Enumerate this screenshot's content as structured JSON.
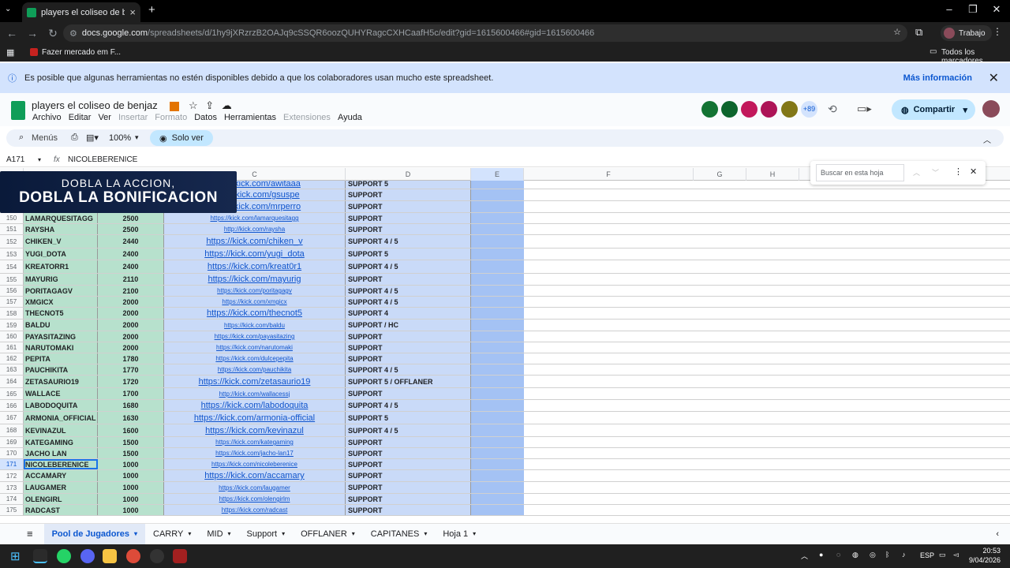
{
  "browser": {
    "tab_title": "players el coliseo de benjaz - H",
    "url_domain": "docs.google.com",
    "url_rest": "/spreadsheets/d/1hy9jXRzrzB2OAJq9cSSQR6oozQUHYRagcCXHCaafH5c/edit?gid=1615600466#gid=1615600466",
    "profile": "Trabajo",
    "bookmark": "Fazer mercado em F...",
    "bookmarks_all": "Todos los marcadores"
  },
  "infobar": {
    "text": "Es posible que algunas herramientas no estén disponibles debido a que los colaboradores usan mucho este spreadsheet.",
    "more": "Más información"
  },
  "doc": {
    "title": "players el coliseo de benjaz",
    "menus": [
      "Archivo",
      "Editar",
      "Ver",
      "Insertar",
      "Formato",
      "Datos",
      "Herramientas",
      "Extensiones",
      "Ayuda"
    ],
    "collaborators_extra": "+89",
    "share": "Compartir"
  },
  "toolbar": {
    "menus": "Menús",
    "zoom": "100%",
    "mode": "Solo ver"
  },
  "formula": {
    "cell": "A171",
    "value": "NICOLEBERENICE"
  },
  "columns": [
    "C",
    "D",
    "E",
    "F",
    "G",
    "H"
  ],
  "search_placeholder": "Buscar en esta hoja",
  "banner": {
    "line1": "DOBLA LA ACCION,",
    "line2": "DOBLA LA BONIFICACION"
  },
  "top_partial": [
    {
      "c": "https://kick.com/awitaaa",
      "d": "SUPPORT 5"
    },
    {
      "c": "https://kick.com/gsuspe",
      "d": "SUPPORT"
    },
    {
      "c": "https://kick.com/mrperro",
      "d": "SUPPORT"
    }
  ],
  "rows": [
    {
      "n": "150",
      "a": "LAMARQUESITAGG",
      "b": "2500",
      "c": "https://kick.com/lamarquesitagg",
      "d": "SUPPORT"
    },
    {
      "n": "151",
      "a": "RAYSHA",
      "b": "2500",
      "c": "http://kick.com/raysha",
      "d": "SUPPORT"
    },
    {
      "n": "152",
      "a": "CHIKEN_V",
      "b": "2440",
      "c": "https://kick.com/chiken_v",
      "d": "SUPPORT 4 / 5"
    },
    {
      "n": "153",
      "a": "YUGI_DOTA",
      "b": "2400",
      "c": "https://kick.com/yugi_dota",
      "d": "SUPPORT 5"
    },
    {
      "n": "154",
      "a": "KREATORR1",
      "b": "2400",
      "c": "https://kick.com/kreat0r1",
      "d": "SUPPORT 4 / 5"
    },
    {
      "n": "155",
      "a": "MAYURIG",
      "b": "2110",
      "c": "https://kick.com/mayurig",
      "d": "SUPPORT"
    },
    {
      "n": "156",
      "a": "PORITAGAGV",
      "b": "2100",
      "c": "https://kick.com/poritagagv",
      "d": "SUPPORT 4 / 5"
    },
    {
      "n": "157",
      "a": "XMGICX",
      "b": "2000",
      "c": "https://kick.com/xmgicx",
      "d": "SUPPORT 4 / 5"
    },
    {
      "n": "158",
      "a": "THECNOT5",
      "b": "2000",
      "c": "https://kick.com/thecnot5",
      "d": "SUPPORT 4"
    },
    {
      "n": "159",
      "a": "BALDU",
      "b": "2000",
      "c": "https://kick.com/baldu",
      "d": "SUPPORT / HC"
    },
    {
      "n": "160",
      "a": "PAYASITAZING",
      "b": "2000",
      "c": "https://kick.com/payasitazing",
      "d": "SUPPORT"
    },
    {
      "n": "161",
      "a": "NARUTOMAKI",
      "b": "2000",
      "c": "https://kick.com/narutomaki",
      "d": "SUPPORT"
    },
    {
      "n": "162",
      "a": "PEPITA",
      "b": "1780",
      "c": "https://kick.com/dulcepepita",
      "d": "SUPPORT"
    },
    {
      "n": "163",
      "a": "PAUCHIKITA",
      "b": "1770",
      "c": "https://kick.com/pauchikita",
      "d": "SUPPORT 4 / 5"
    },
    {
      "n": "164",
      "a": "ZETASAURIO19",
      "b": "1720",
      "c": "https://kick.com/zetasaurio19",
      "d": "SUPPORT 5 / OFFLANER"
    },
    {
      "n": "165",
      "a": "WALLACE",
      "b": "1700",
      "c": "http://kick.com/wallacessj",
      "d": "SUPPORT"
    },
    {
      "n": "166",
      "a": "LABODOQUITA",
      "b": "1680",
      "c": "https://kick.com/labodoquita",
      "d": "SUPPORT 4 / 5"
    },
    {
      "n": "167",
      "a": "ARMONIA_OFFICIAL",
      "b": "1630",
      "c": "https://kick.com/armonia-official",
      "d": "SUPPORT 5"
    },
    {
      "n": "168",
      "a": "KEVINAZUL",
      "b": "1600",
      "c": "https://kick.com/kevinazul",
      "d": "SUPPORT 4 / 5"
    },
    {
      "n": "169",
      "a": "KATEGAMING",
      "b": "1500",
      "c": "https://kick.com/kategaming",
      "d": "SUPPORT"
    },
    {
      "n": "170",
      "a": "JACHO LAN",
      "b": "1500",
      "c": "https://kick.com/jacho-lan17",
      "d": "SUPPORT"
    },
    {
      "n": "171",
      "a": "NICOLEBERENICE",
      "b": "1000",
      "c": "https://kick.com/nicoleberenice",
      "d": "SUPPORT"
    },
    {
      "n": "172",
      "a": "ACCAMARY",
      "b": "1000",
      "c": "https://kick.com/accamary",
      "d": "SUPPORT"
    },
    {
      "n": "173",
      "a": "LAUGAMER",
      "b": "1000",
      "c": "https://kick.com/laugamer",
      "d": "SUPPORT"
    },
    {
      "n": "174",
      "a": "OLENGIRL",
      "b": "1000",
      "c": "https://kick.com/olengirlm",
      "d": "SUPPORT"
    },
    {
      "n": "175",
      "a": "RADCAST",
      "b": "1000",
      "c": "https://kick.com/radcast",
      "d": "SUPPORT"
    }
  ],
  "sheet_tabs": [
    "Pool de Jugadores",
    "CARRY",
    "MID",
    "Support",
    "OFFLANER",
    "CAPITANES",
    "Hoja 1"
  ],
  "taskbar": {
    "lang": "ESP",
    "time": "20:53",
    "date": "9/04/2026"
  }
}
